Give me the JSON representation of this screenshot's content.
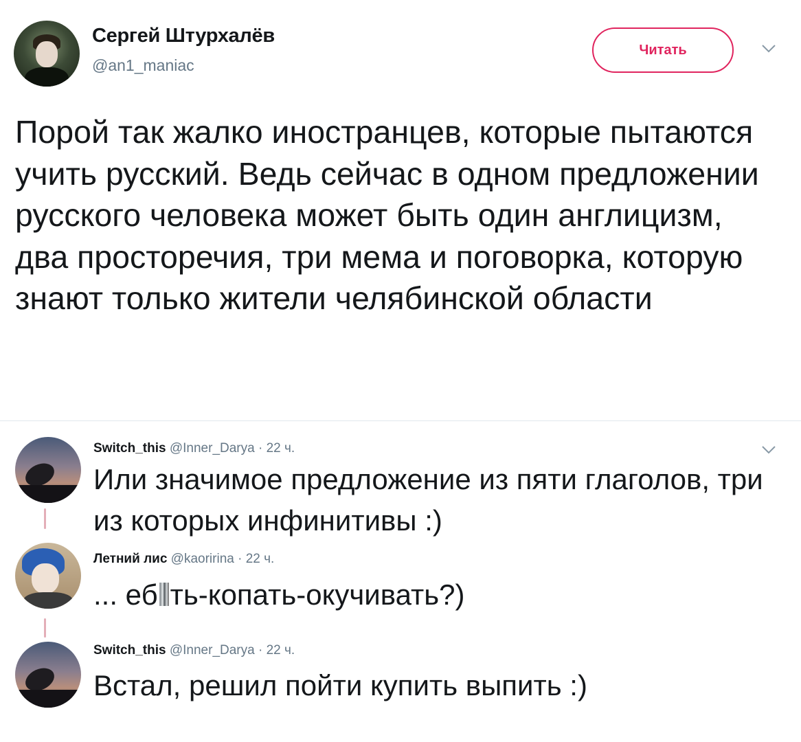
{
  "main_tweet": {
    "author_name": "Сергей Штурхалёв",
    "author_handle": "@an1_maniac",
    "follow_label": "Читать",
    "text": "Порой так жалко иностранцев, которые пытаются учить русский.  Ведь сейчас в одном предложении русского человека может быть один англицизм, два просторечия, три мема и поговорка, которую знают только жители челябинской области",
    "icons": {
      "avatar": "user-avatar-icon",
      "menu": "chevron-down-icon"
    }
  },
  "replies": [
    {
      "name": "Switch_this",
      "handle": "@Inner_Darya",
      "time": "· 22 ч.",
      "text": "Или значимое предложение из пяти глаголов, три из которых инфинитивы :)",
      "avatar": "radio-telescope-avatar"
    },
    {
      "name": "Летний лис",
      "handle": "@kaoririna",
      "time": "· 22 ч.",
      "text_before": "... еб",
      "text_after": "ть-копать-окучивать?)",
      "avatar": "blue-hair-avatar"
    },
    {
      "name": "Switch_this",
      "handle": "@Inner_Darya",
      "time": "· 22 ч.",
      "text": "Встал, решил пойти купить выпить :)",
      "avatar": "radio-telescope-avatar"
    }
  ],
  "colors": {
    "accent": "#e0245e",
    "secondary_text": "#657786",
    "thread_line": "#e3aeb8"
  }
}
